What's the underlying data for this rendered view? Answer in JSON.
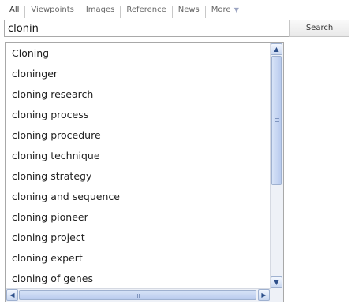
{
  "tabs": [
    {
      "label": "All"
    },
    {
      "label": "Viewpoints"
    },
    {
      "label": "Images"
    },
    {
      "label": "Reference"
    },
    {
      "label": "News"
    },
    {
      "label": "More",
      "icon": "triangle-down-icon",
      "glyph": "▼"
    }
  ],
  "search": {
    "value": "clonin",
    "button_label": "Search"
  },
  "suggestions": [
    "Cloning",
    "cloninger",
    "cloning research",
    "cloning process",
    "cloning procedure",
    "cloning technique",
    "cloning strategy",
    "cloning and sequence",
    "cloning pioneer",
    "cloning project",
    "cloning expert",
    "cloning of genes"
  ],
  "scrollbar": {
    "up_glyph": "▲",
    "down_glyph": "▼",
    "left_glyph": "◀",
    "right_glyph": "▶"
  }
}
